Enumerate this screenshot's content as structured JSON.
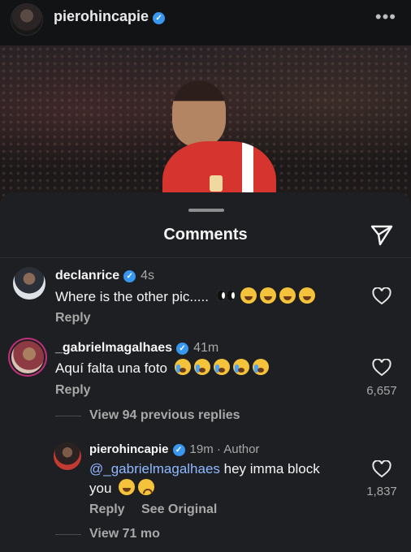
{
  "header": {
    "username": "pierohincapie",
    "verified_icon": "verified-badge-icon",
    "more_icon": "more-horizontal-icon"
  },
  "sheet": {
    "title": "Comments",
    "share_icon": "send-icon"
  },
  "comments": [
    {
      "username": "declanrice",
      "time": "4s",
      "text": "Where is the other pic.....",
      "emojis": [
        "eyes",
        "rofl",
        "rofl",
        "rofl",
        "rofl"
      ],
      "reply_label": "Reply",
      "likes": ""
    },
    {
      "username": "_gabrielmagalhaes",
      "time": "41m",
      "text": "Aquí falta una foto",
      "emojis": [
        "sob",
        "sob",
        "sob",
        "sob",
        "sob"
      ],
      "reply_label": "Reply",
      "likes": "6,657",
      "view_replies": "View 94 previous replies"
    }
  ],
  "reply": {
    "username": "pierohincapie",
    "time": "19m",
    "author_label": "· Author",
    "mention": "@_gabrielmagalhaes",
    "text_line1": " hey imma block",
    "text_line2": "you",
    "emojis": [
      "joy",
      "frowning"
    ],
    "reply_label": "Reply",
    "see_original": "See Original",
    "likes": "1,837",
    "view_more": "View 71 mo"
  },
  "colors": {
    "background": "#1e1f22",
    "verified": "#3897f0",
    "mention": "#8fb8ff",
    "muted": "#a8a8a8"
  }
}
